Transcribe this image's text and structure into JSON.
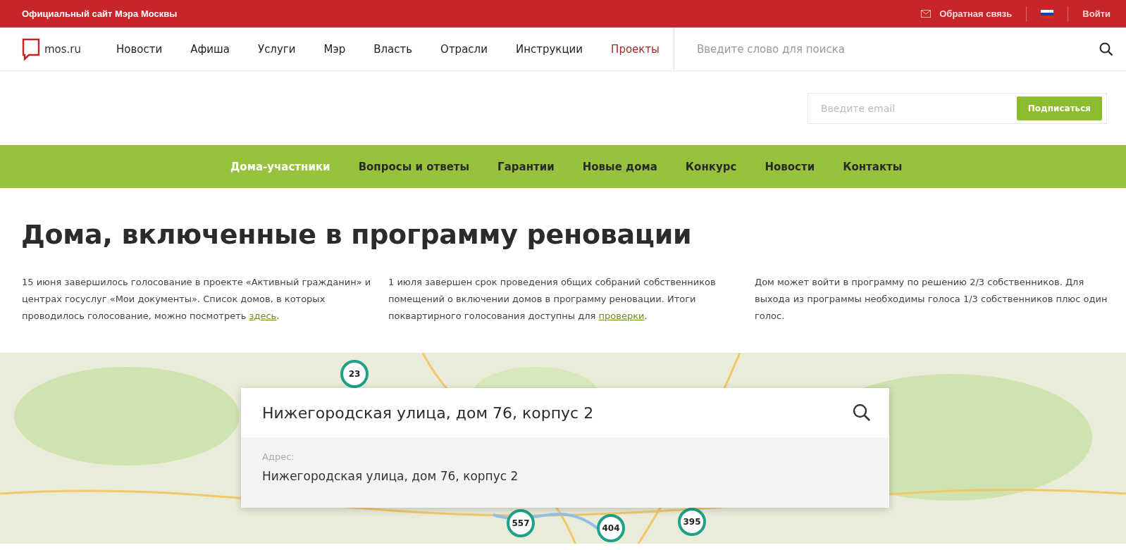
{
  "top_bar": {
    "title": "Официальный сайт Мэра Москвы",
    "feedback": "Обратная связь",
    "login": "Войти"
  },
  "header": {
    "logo": "mos.ru",
    "nav": [
      {
        "label": "Новости",
        "selected": false
      },
      {
        "label": "Афиша",
        "selected": false
      },
      {
        "label": "Услуги",
        "selected": false
      },
      {
        "label": "Мэр",
        "selected": false
      },
      {
        "label": "Власть",
        "selected": false
      },
      {
        "label": "Отрасли",
        "selected": false
      },
      {
        "label": "Инструкции",
        "selected": false
      },
      {
        "label": "Проекты",
        "selected": true
      }
    ],
    "search": {
      "placeholder": "Введите слово для поиска"
    }
  },
  "subscribe": {
    "placeholder": "Введите email",
    "button": "Подписаться"
  },
  "section_nav": [
    {
      "label": "Дома-участники",
      "selected": true
    },
    {
      "label": "Вопросы и ответы",
      "selected": false
    },
    {
      "label": "Гарантии",
      "selected": false
    },
    {
      "label": "Новые дома",
      "selected": false
    },
    {
      "label": "Конкурс",
      "selected": false
    },
    {
      "label": "Новости",
      "selected": false
    },
    {
      "label": "Контакты",
      "selected": false
    }
  ],
  "page_title": "Дома, включенные в программу реновации",
  "info_columns": [
    {
      "text": "15 июня завершилось голосование в проекте «Активный гражданин» и центрах госуслуг «Мои документы». Список домов, в которых проводилось голосование, можно посмотреть ",
      "link": "здесь",
      "after": "."
    },
    {
      "text": "1 июля завершен срок проведения общих собраний собственников помещений о включении домов в программу реновации. Итоги поквартирного голосования доступны для ",
      "link": "проверки",
      "after": "."
    },
    {
      "text": "Дом может войти в программу по решению 2/3 собственников. Для выхода из программы необходимы голоса 1/3 собственников плюс один голос."
    }
  ],
  "map": {
    "clusters": [
      "23",
      "557",
      "404",
      "395"
    ],
    "search": {
      "value": "Нижегородская улица, дом 76, корпус 2",
      "result_label": "Адрес:",
      "result_value": "Нижегородская улица, дом 76, корпус 2"
    }
  }
}
